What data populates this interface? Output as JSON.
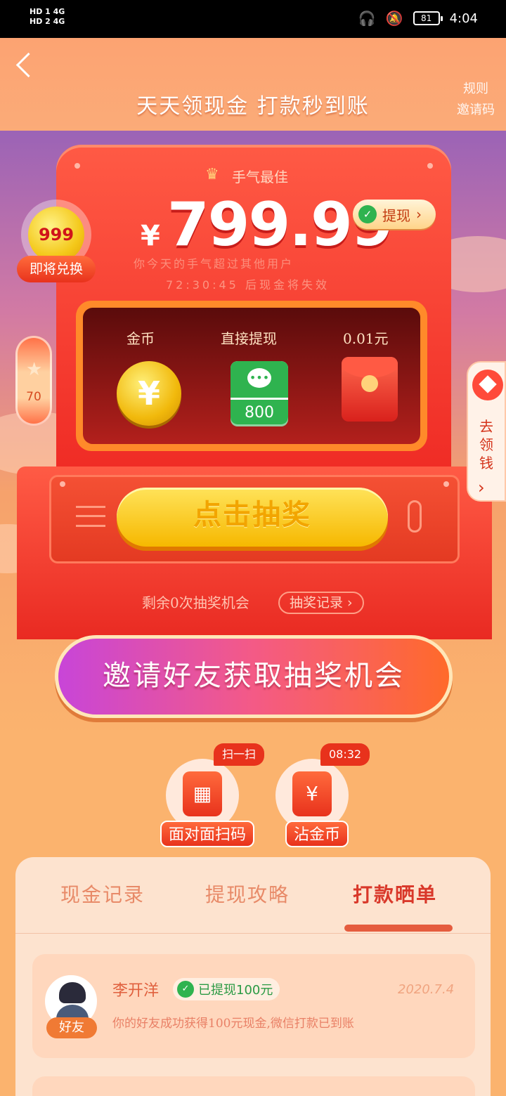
{
  "status_bar": {
    "left_top": "HD 1  4G",
    "left_bottom": "HD 2  4G",
    "battery": "81",
    "time": "4:04"
  },
  "header": {
    "title": "天天领现金 打款秒到账",
    "link_rules": "规则",
    "link_invite_code": "邀请码"
  },
  "hero": {
    "luck_label": "手气最佳",
    "currency": "¥",
    "amount": "799.99",
    "withdraw_label": "提现",
    "sub_line1": "你今天的手气超过其他用户",
    "sub_line2": "72:30:45 后现金将失效"
  },
  "prizes": [
    {
      "label": "金币",
      "icon": "coin-icon",
      "symbol": "¥"
    },
    {
      "label": "直接提现",
      "icon": "wechat-cash-icon",
      "value": "800"
    },
    {
      "label": "0.01元",
      "icon": "red-packet-icon"
    }
  ],
  "draw": {
    "button": "点击抽奖",
    "remaining": "剩余0次抽奖机会",
    "record_link": "抽奖记录"
  },
  "invite_button": "邀请好友获取抽奖机会",
  "left_widgets": {
    "coin_badge": "999",
    "exchange": "即将兑换",
    "capsule_value": "70"
  },
  "right_tab": {
    "label": "去领钱"
  },
  "actions": [
    {
      "tag": "扫一扫",
      "label": "面对面扫码",
      "icon": "qr-code-icon"
    },
    {
      "tag": "08:32",
      "label": "沾金币",
      "icon": "treasure-chest-icon"
    }
  ],
  "tabs": [
    "现金记录",
    "提现攻略",
    "打款晒单"
  ],
  "active_tab": "打款晒单",
  "records": [
    {
      "name": "李开洋",
      "badge": "已提现100元",
      "date": "2020.7.4",
      "message": "你的好友成功获得100元现金,微信打款已到账",
      "tag": "好友"
    }
  ],
  "colors": {
    "primary_red": "#e8321c",
    "accent_orange": "#fbb36e",
    "wechat_green": "#2fb34f",
    "gold": "#f6b800"
  }
}
